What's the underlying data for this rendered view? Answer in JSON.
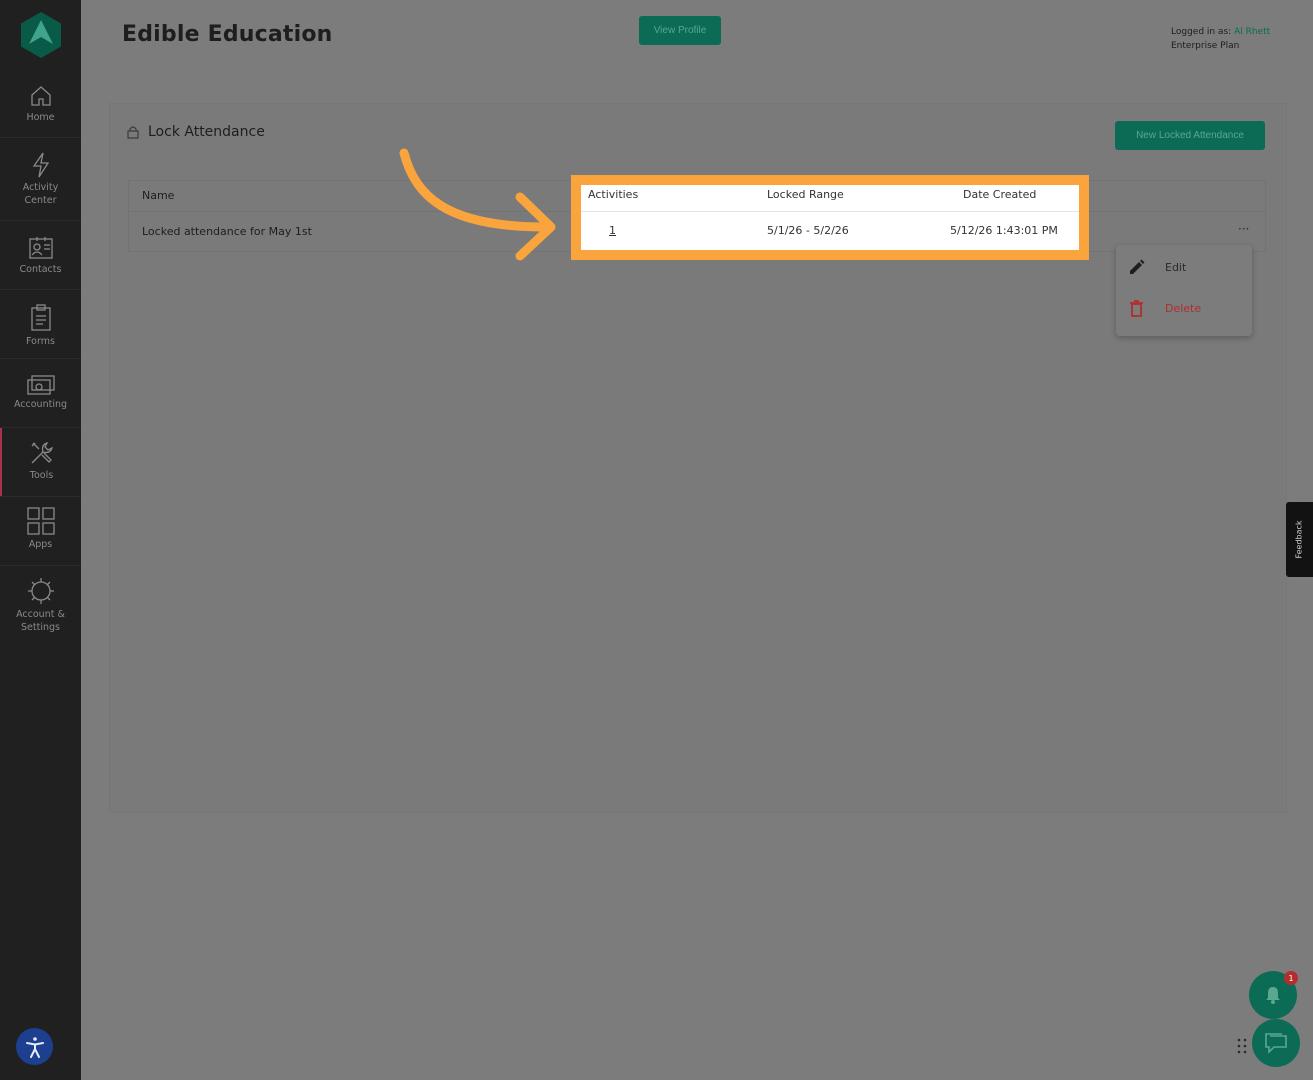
{
  "sidebar": {
    "items": [
      {
        "label": "Home"
      },
      {
        "label": "Activity Center"
      },
      {
        "label": "Contacts"
      },
      {
        "label": "Forms"
      },
      {
        "label": "Accounting"
      },
      {
        "label": "Tools"
      },
      {
        "label": "Apps"
      },
      {
        "label": "Account & Settings"
      }
    ],
    "active": "Tools"
  },
  "header": {
    "title": "Edible Education",
    "view_profile_label": "View Profile",
    "logged_in_prefix": "Logged in as:",
    "user_name": "Al Rhett",
    "plan": "Enterprise Plan"
  },
  "card": {
    "title": "Lock Attendance",
    "new_button_label": "New Locked Attendance"
  },
  "table": {
    "columns": [
      "Name",
      "Activities",
      "Locked Range",
      "Date Created"
    ],
    "rows": [
      {
        "name": "Locked attendance for May 1st",
        "activities": "1",
        "locked_range": "5/1/26 - 5/2/26",
        "date_created": "5/12/26 1:43:01 PM"
      }
    ],
    "row_menu_label": "···"
  },
  "dropdown": {
    "edit_label": "Edit",
    "delete_label": "Delete"
  },
  "feedback_label": "Feedback",
  "notifications": {
    "badge_count": "1"
  },
  "colors": {
    "accent": "#0b6b55",
    "highlight": "#f9a43d",
    "danger": "#b32d2d"
  }
}
